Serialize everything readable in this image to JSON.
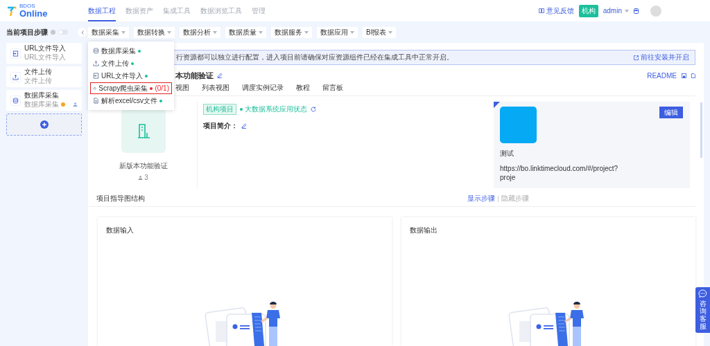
{
  "header": {
    "logo_small": "BDOS",
    "logo_name": "Online",
    "nav": [
      {
        "label": "数据工程",
        "selected": true
      },
      {
        "label": "数据资产",
        "selected": false
      },
      {
        "label": "集成工具",
        "selected": false
      },
      {
        "label": "数据浏览工具",
        "selected": false
      },
      {
        "label": "管理",
        "selected": false
      }
    ],
    "feedback": "意见反馈",
    "org_badge": "机构",
    "user": "admin"
  },
  "sidebar": {
    "title": "当前项目步骤",
    "on": false,
    "items": [
      {
        "kind": "import",
        "title": "URL文件导入",
        "subtitle": "URL文件导入",
        "warning": false,
        "shared": false
      },
      {
        "kind": "upload",
        "title": "文件上传",
        "subtitle": "文件上传",
        "warning": false,
        "shared": false
      },
      {
        "kind": "database",
        "title": "数据库采集",
        "subtitle": "数据库采集",
        "warning": true,
        "shared": true
      }
    ]
  },
  "toolbar": [
    "数据采集",
    "数据转换",
    "数据分析",
    "数据质量",
    "数据服务",
    "数据应用",
    "BI报表"
  ],
  "menu": [
    {
      "kind": "database",
      "label": "数据库采集",
      "color": "#1cbf9b",
      "highlighted": false
    },
    {
      "kind": "upload",
      "label": "文件上传",
      "color": "#1cbf9b",
      "highlighted": false
    },
    {
      "kind": "import",
      "label": "URL文件导入",
      "color": "#1cbf9b",
      "highlighted": false
    },
    {
      "kind": "spider",
      "label": "Scrapy爬虫采集",
      "color": "#f5222d",
      "count": "(0/1)",
      "highlighted": true
    },
    {
      "kind": "file",
      "label": "解析excel/csv文件",
      "color": "#1cbf9b",
      "highlighted": false
    }
  ],
  "banner": {
    "text": "行资源都可以独立进行配置，进入项目前请确保对应资源组件已经在集成工具中正常开启。",
    "link": "前往安装并开启"
  },
  "project": {
    "title": "本功能验证",
    "readme": "README",
    "tabs": [
      "视图",
      "列表视图",
      "调度实例记录",
      "教程",
      "留言板"
    ]
  },
  "overview": {
    "name": "新版本功能验证",
    "members": "3",
    "tag": "机构项目",
    "status": "大数据系统应用状态",
    "intro_label": "项目简介："
  },
  "info_card": {
    "button": "编辑",
    "name": "测试",
    "url": "https://bo.linktimecloud.com/#/project?",
    "url_cut": "proje"
  },
  "structure": {
    "title": "项目指导图结构",
    "toggles": [
      {
        "label": "显示步骤",
        "selected": true
      },
      {
        "label": "隐藏步骤",
        "selected": false
      }
    ],
    "panels": [
      "数据输入",
      "数据输出"
    ]
  },
  "support": "咨询客服"
}
